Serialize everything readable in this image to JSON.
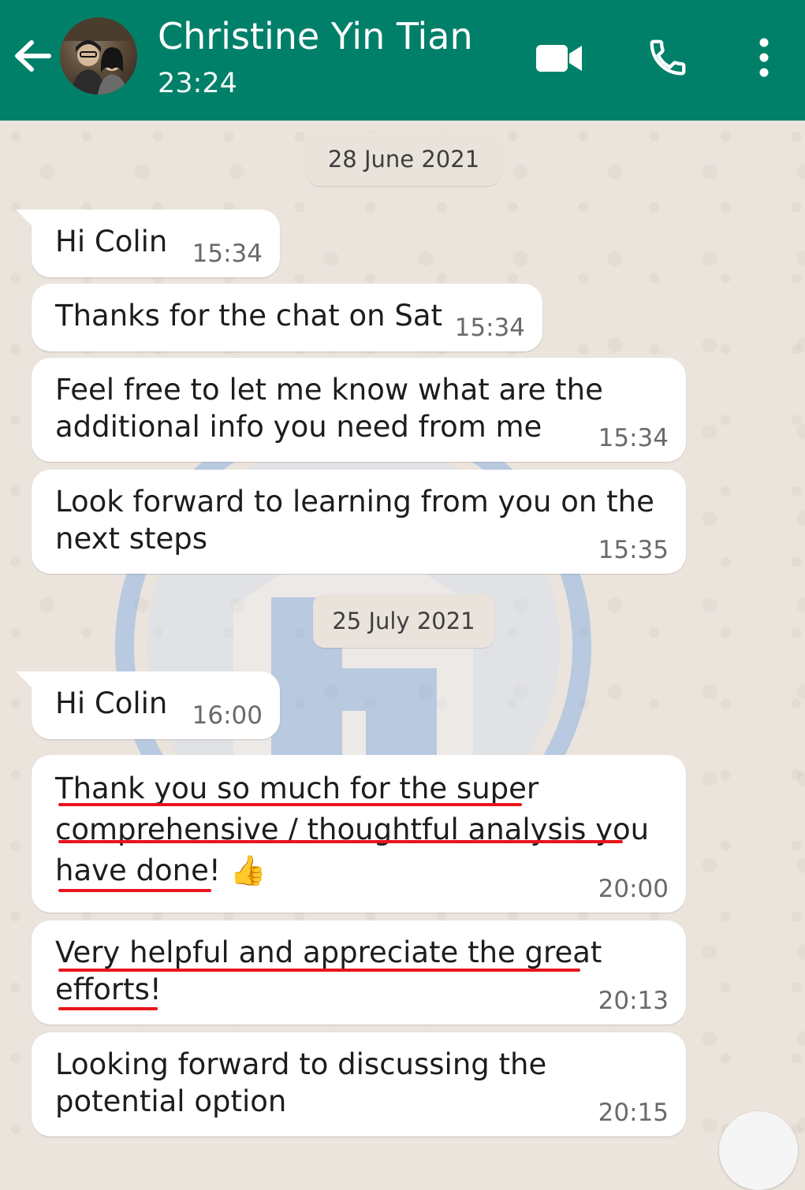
{
  "header": {
    "contact_name": "Christine Yin Tian",
    "last_seen": "23:24",
    "icons": [
      "back-arrow-icon",
      "video-call-icon",
      "voice-call-icon",
      "more-options-icon"
    ]
  },
  "dates": [
    "28 June 2021",
    "25 July 2021"
  ],
  "messages": [
    {
      "text": "Hi Colin",
      "time": "15:34"
    },
    {
      "text": "Thanks for the chat on Sat",
      "time": "15:34"
    },
    {
      "text": "Feel free to let me know what are the\nadditional info you need from me",
      "time": "15:34"
    },
    {
      "text": "Look forward to learning from you on the\nnext steps",
      "time": "15:35"
    },
    {
      "text": "Hi Colin",
      "time": "16:00"
    },
    {
      "text": "Thank you so much for the super\ncomprehensive / thoughtful analysis you\nhave done! 👍",
      "time": "20:00"
    },
    {
      "text": "Very helpful and appreciate the great\nefforts!",
      "time": "20:13"
    },
    {
      "text": "Looking forward to discussing the\npotential option",
      "time": "20:15"
    }
  ],
  "colors": {
    "header": "#008069",
    "chat_background": "#ebe4dc",
    "bubble": "#ffffff",
    "highlight_underline": "#e8141b",
    "watermark": "#4f8fe6"
  }
}
